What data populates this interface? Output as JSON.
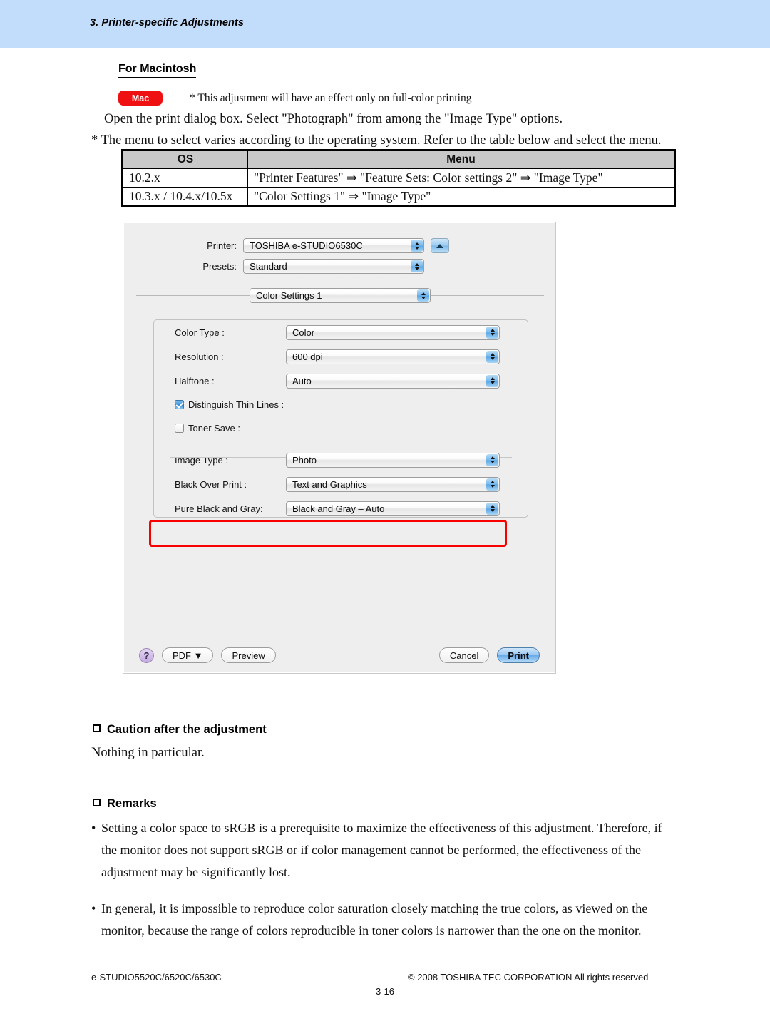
{
  "page_header": {
    "chapter": "3. Printer-specific Adjustments"
  },
  "section": {
    "title": "For Macintosh",
    "badge": "Mac",
    "badge_note": "* This adjustment will have an effect only on full-color printing",
    "instruction": "Open the print dialog box.  Select \"Photograph\" from among the \"Image Type\" options.",
    "note": "* The menu to select varies according to the operating system.  Refer to the table below and select the menu."
  },
  "os_table": {
    "headers": [
      "OS",
      "Menu"
    ],
    "rows": [
      {
        "os": "10.2.x",
        "menu": "\"Printer Features\" ⇒ \"Feature Sets: Color settings 2\" ⇒ \"Image Type\""
      },
      {
        "os": "10.3.x / 10.4.x/10.5x",
        "menu": "\"Color Settings 1\" ⇒ \"Image Type\""
      }
    ]
  },
  "dialog": {
    "printer_label": "Printer:",
    "printer_value": "TOSHIBA e-STUDIO6530C",
    "presets_label": "Presets:",
    "presets_value": "Standard",
    "pane_value": "Color Settings 1",
    "settings": [
      {
        "label": "Color Type :",
        "value": "Color"
      },
      {
        "label": "Resolution :",
        "value": "600 dpi"
      },
      {
        "label": "Halftone :",
        "value": "Auto"
      }
    ],
    "checkboxes": [
      {
        "label": "Distinguish Thin Lines :",
        "checked": true
      },
      {
        "label": "Toner Save :",
        "checked": false
      }
    ],
    "settings2": [
      {
        "label": "Image Type :",
        "value": "Photo"
      },
      {
        "label": "Black Over Print :",
        "value": "Text and Graphics"
      },
      {
        "label": "Pure Black and Gray:",
        "value": "Black and Gray – Auto"
      }
    ],
    "help_label": "?",
    "pdf_label": "PDF ▼",
    "preview_label": "Preview",
    "cancel_label": "Cancel",
    "print_label": "Print",
    "highlight_color": "#f80000"
  },
  "caution": {
    "heading": "Caution after the adjustment",
    "text": "Nothing in particular."
  },
  "remarks": {
    "heading": "Remarks",
    "items": [
      {
        "line1": "Setting a color space to sRGB is a prerequisite to maximize the effectiveness of this adjustment.  Therefore, if",
        "line2": "the monitor does not support sRGB or if color management cannot be performed, the effectiveness of the",
        "line3": "adjustment may be significantly lost."
      },
      {
        "line1": "In general, it is impossible to reproduce color saturation closely matching the true colors, as viewed on the",
        "line2": "monitor, because the range of colors reproducible in toner colors is narrower than the one on the monitor.",
        "line3": ""
      }
    ]
  },
  "footer": {
    "left": "e-STUDIO5520C/6520C/6530C",
    "right": "© 2008 TOSHIBA TEC CORPORATION All rights reserved",
    "page": "3-16"
  }
}
